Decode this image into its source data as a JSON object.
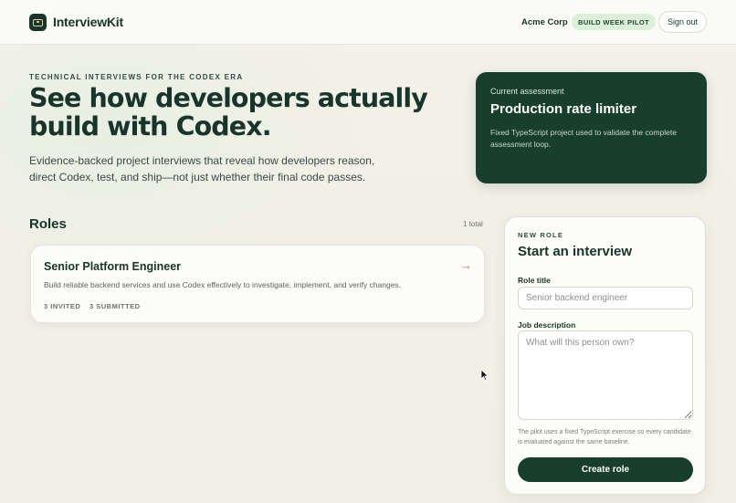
{
  "header": {
    "brand": "InterviewKit",
    "org": "Acme Corp",
    "badge": "BUILD WEEK PILOT",
    "signout_label": "Sign out"
  },
  "hero": {
    "eyebrow": "TECHNICAL INTERVIEWS FOR THE CODEX ERA",
    "title": "See how developers actually build with Codex.",
    "subtitle": "Evidence-backed project interviews that reveal how developers reason, direct Codex, test, and ship—not just whether their final code passes."
  },
  "assessment": {
    "label": "Current assessment",
    "title": "Production rate limiter",
    "description": "Fixed TypeScript project used to validate the complete assessment loop."
  },
  "roles": {
    "title": "Roles",
    "count": "1 total",
    "items": [
      {
        "name": "Senior Platform Engineer",
        "description": "Build reliable backend services and use Codex effectively to investigate, implement, and verify changes.",
        "invited": "3 INVITED",
        "submitted": "3 SUBMITTED",
        "arrow": "→"
      }
    ]
  },
  "form": {
    "eyebrow": "NEW ROLE",
    "heading": "Start an interview",
    "role_title_label": "Role title",
    "role_title_placeholder": "Senior backend engineer",
    "job_description_label": "Job description",
    "job_description_placeholder": "What will this person own?",
    "note": "The pilot uses a fixed TypeScript exercise so every candidate is evaluated against the same baseline.",
    "create_label": "Create role"
  },
  "colors": {
    "brand_dark": "#173f2c",
    "badge_bg": "#dcefd8",
    "arrow_accent": "#d06a50"
  },
  "icons": {
    "logo": "interviewkit-logo-icon",
    "arrow": "arrow-right-icon",
    "cursor": "mouse-pointer-icon"
  }
}
